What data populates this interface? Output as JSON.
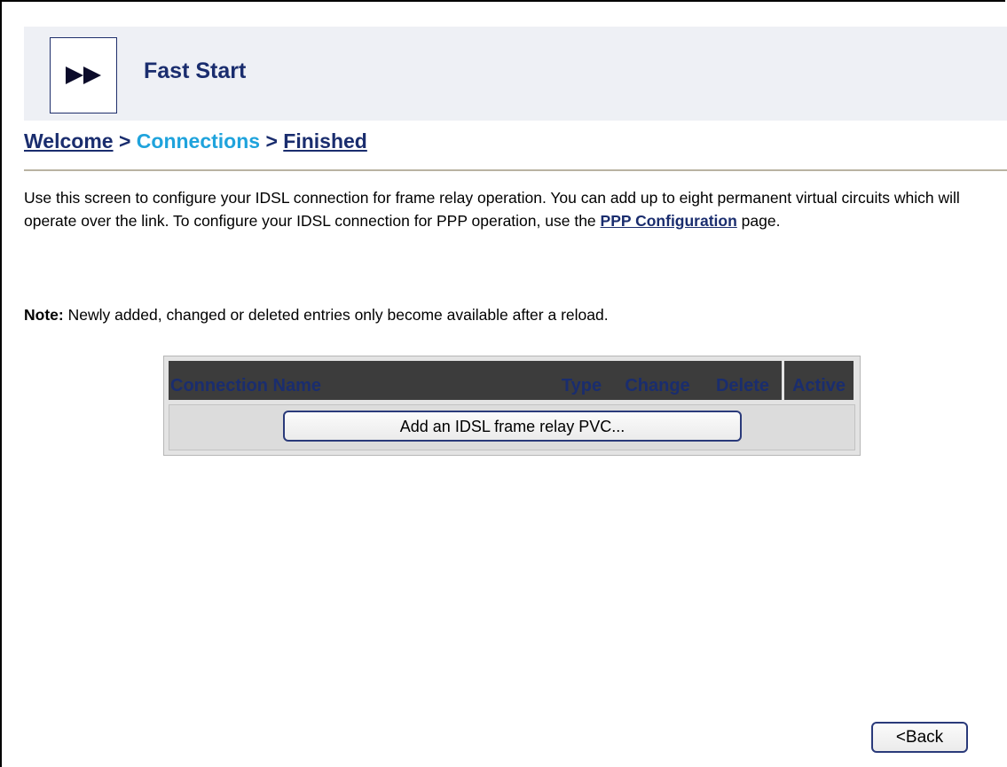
{
  "header": {
    "title": "Fast Start",
    "logo_icon": "fast-forward-icon"
  },
  "breadcrumb": {
    "step1": "Welcome",
    "sep1": ">",
    "step2": "Connections",
    "sep2": ">",
    "step3": "Finished"
  },
  "intro": {
    "text_before": "Use this screen to configure your IDSL connection for frame relay operation. You can add up to eight permanent virtual circuits which will operate over the link. To configure your IDSL connection for PPP operation, use the ",
    "link": "PPP Configuration",
    "text_after": " page."
  },
  "note": {
    "label": "Note:",
    "text": " Newly added, changed or deleted entries only become available after a reload."
  },
  "table": {
    "columns": [
      "Connection Name",
      "Type",
      "Change",
      "Delete",
      "Active"
    ],
    "add_button": "Add an IDSL frame relay PVC..."
  },
  "footer": {
    "back_button": "<Back"
  },
  "colors": {
    "title": "#1a2d6e",
    "current_step": "#1fa3dc",
    "header_band": "#eef0f5",
    "table_header_bg": "#3c3c3c"
  }
}
